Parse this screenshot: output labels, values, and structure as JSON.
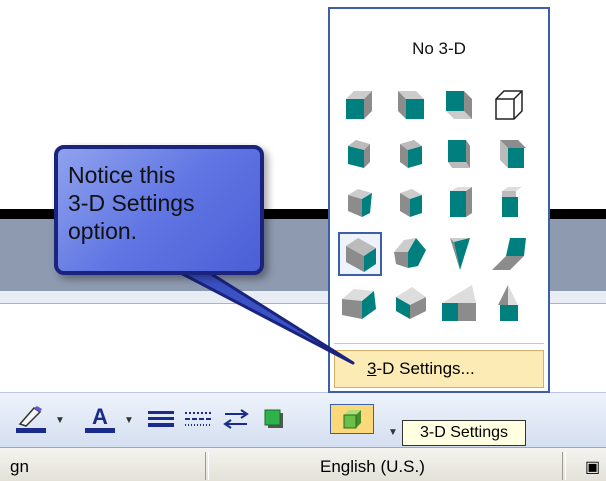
{
  "document": {},
  "popup": {
    "title": "No 3-D",
    "shapes": [
      "3d-style-1",
      "3d-style-2",
      "3d-style-3",
      "3d-style-4",
      "3d-style-5",
      "3d-style-6",
      "3d-style-7",
      "3d-style-8",
      "3d-style-9",
      "3d-style-10",
      "3d-style-11",
      "3d-style-12",
      "3d-style-13",
      "3d-style-14",
      "3d-style-15",
      "3d-style-16",
      "3d-style-17",
      "3d-style-18",
      "3d-style-19",
      "3d-style-20"
    ],
    "selected_index": 12,
    "settings_label": "3-D Settings...",
    "settings_accel": "3"
  },
  "toolbar": {
    "items": [
      "line-color-icon",
      "font-color-icon",
      "line-style-icon",
      "dash-style-icon",
      "arrow-style-icon",
      "shadow-style-icon",
      "3d-style-icon"
    ],
    "tooltip": "3-D Settings"
  },
  "status": {
    "left_text": "gn",
    "language": "English (U.S.)"
  },
  "callout": {
    "lines": [
      "Notice this",
      "3-D Settings",
      "option."
    ]
  },
  "colors": {
    "face": "#007f7f",
    "side": "#8c8c8c",
    "accent": "#3d5fa8",
    "callout": "#6176e3",
    "hover": "#fdebb6"
  }
}
